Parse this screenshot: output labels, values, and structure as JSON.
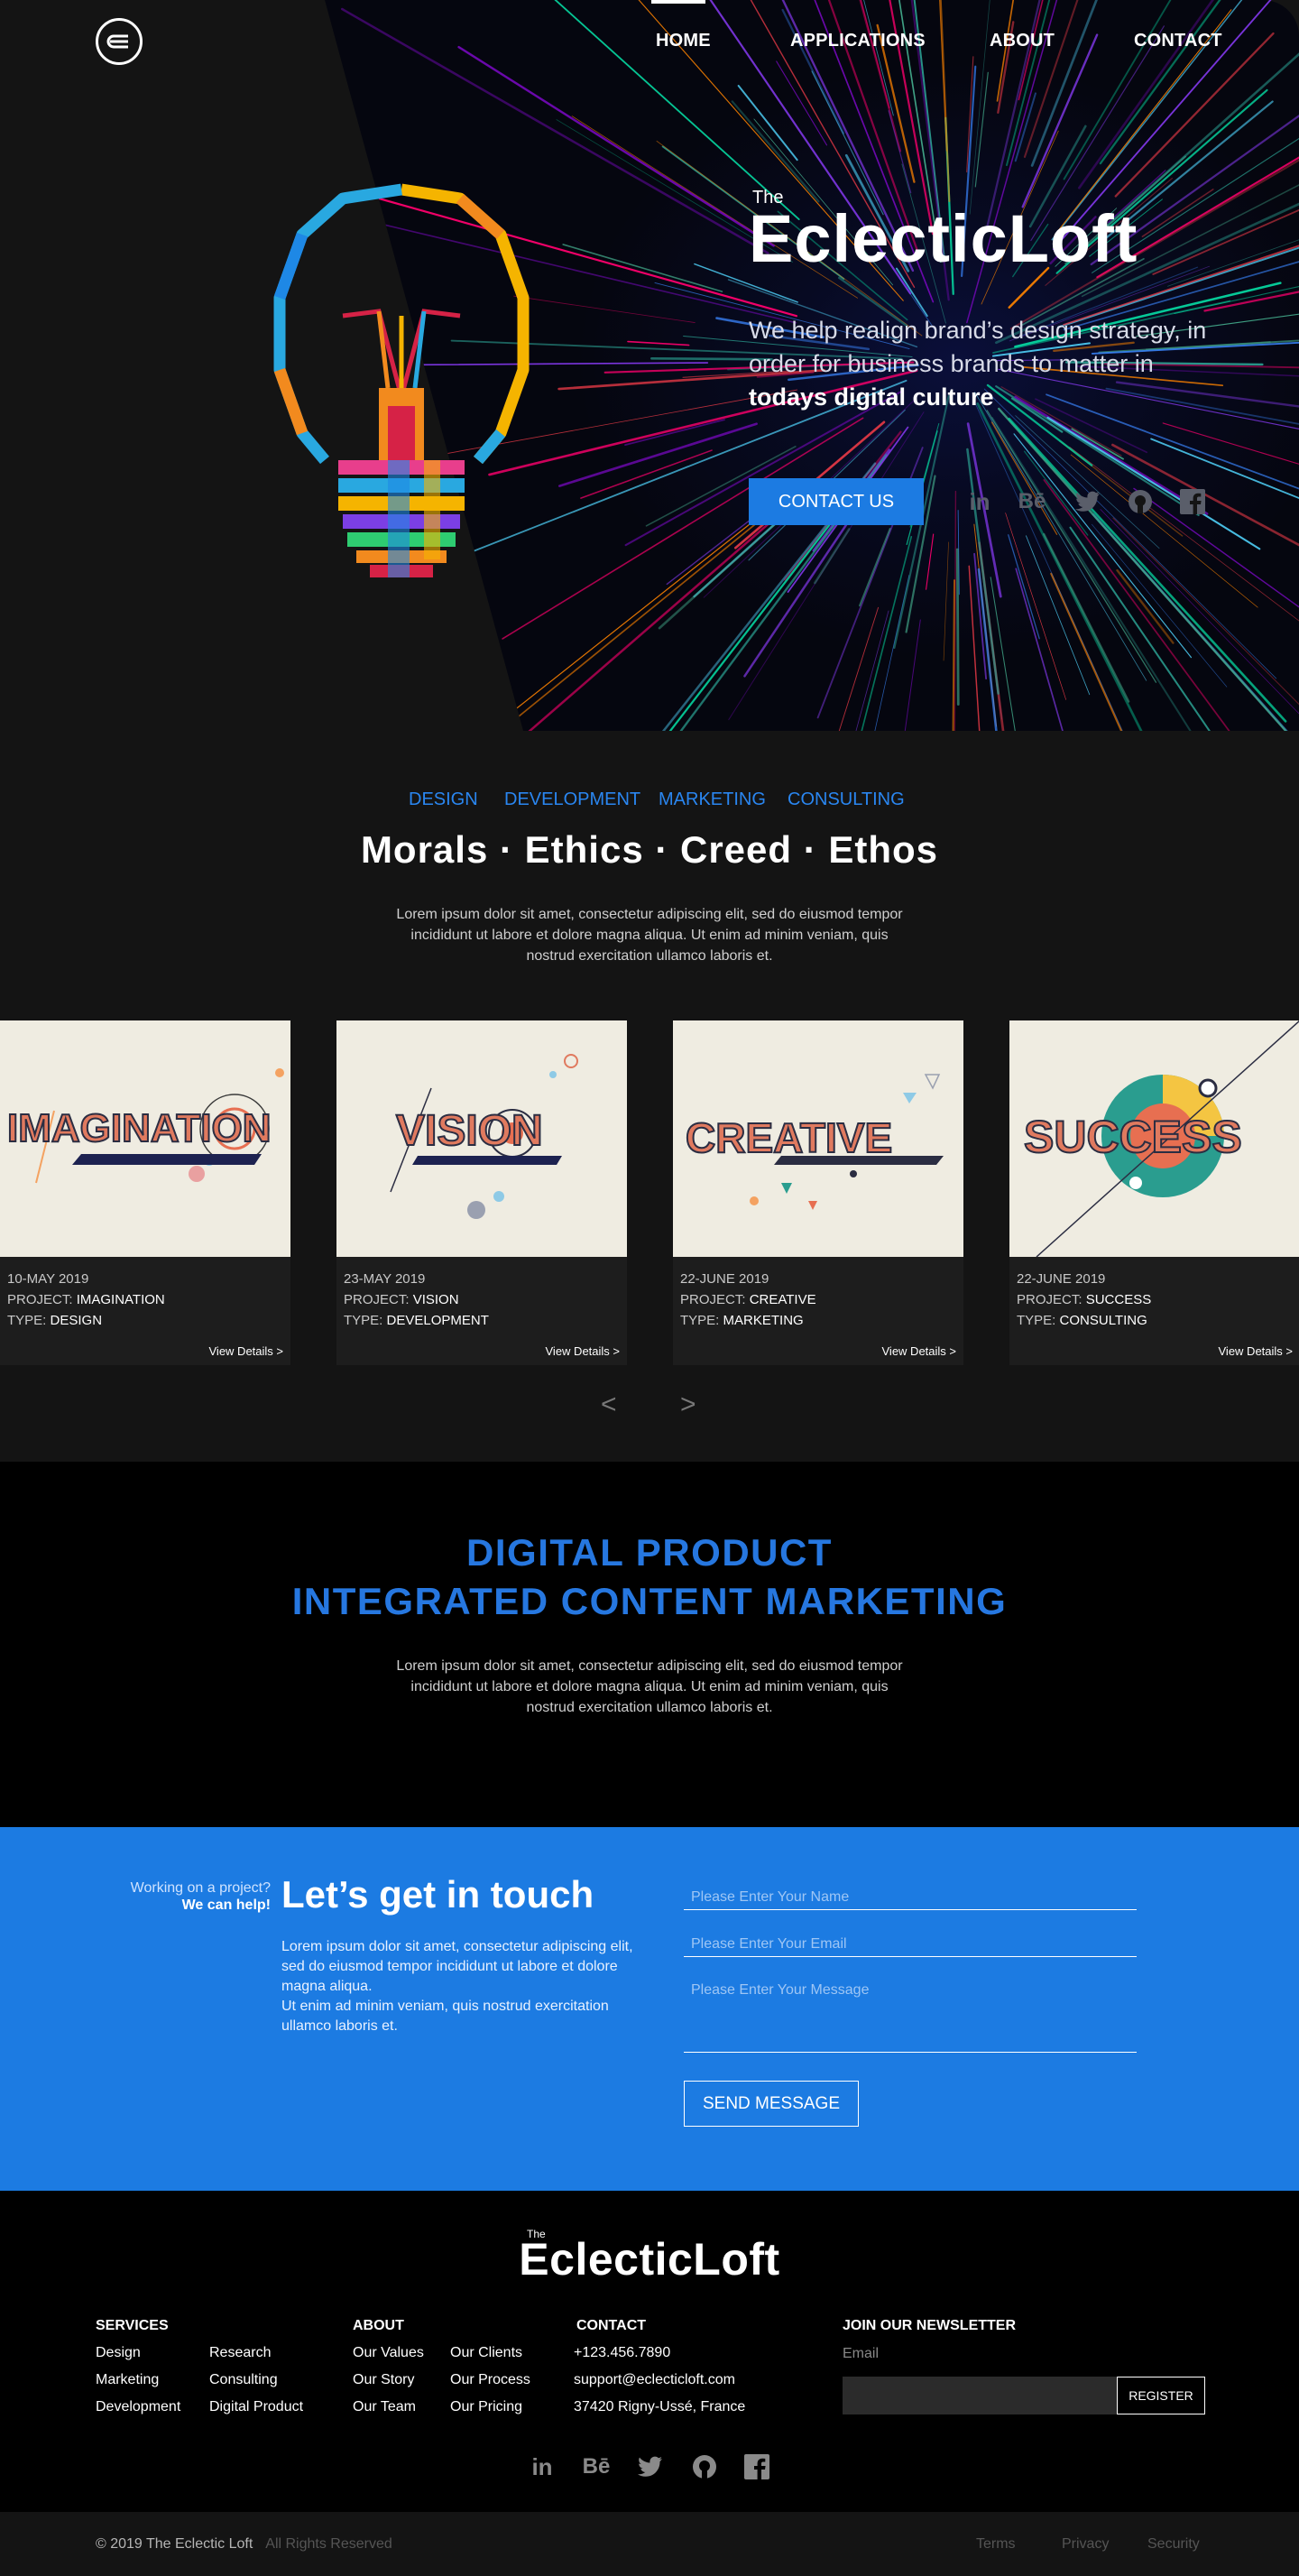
{
  "nav": {
    "items": [
      "HOME",
      "APPLICATIONS",
      "ABOUT",
      "CONTACT"
    ],
    "active": "HOME"
  },
  "hero": {
    "the": "The",
    "title": "EclecticLoft",
    "tagline": "We help realign brand’s design strategy, in order for business brands to matter in",
    "tagline_bold": "todays digital culture",
    "cta": "CONTACT US",
    "social_icons": [
      "linkedin-icon",
      "behance-icon",
      "twitter-icon",
      "github-icon",
      "facebook-icon"
    ],
    "accent": "#1c7be2"
  },
  "services": {
    "categories": [
      "DESIGN",
      "DEVELOPMENT",
      "MARKETING",
      "CONSULTING"
    ],
    "headline": "Morals · Ethics · Creed · Ethos",
    "body_line1": "Lorem ipsum dolor sit amet, consectetur adipiscing elit, sed do eiusmod tempor",
    "body_line2": "incididunt ut labore et dolore magna aliqua. Ut enim ad minim veniam, quis",
    "body_line3": "nostrud exercitation ullamco laboris et."
  },
  "projects": [
    {
      "word": "IMAGINATION",
      "date": "10-MAY 2019",
      "project_label": "PROJECT:",
      "project": "IMAGINATION",
      "type_label": "TYPE:",
      "type": "DESIGN",
      "link": "View Details >"
    },
    {
      "word": "VISION",
      "date": "23-MAY 2019",
      "project_label": "PROJECT:",
      "project": "VISION",
      "type_label": "TYPE:",
      "type": "DEVELOPMENT",
      "link": "View Details >"
    },
    {
      "word": "CREATIVE",
      "date": "22-JUNE 2019",
      "project_label": "PROJECT:",
      "project": "CREATIVE",
      "type_label": "TYPE:",
      "type": "MARKETING",
      "link": "View Details >"
    },
    {
      "word": "SUCCESS",
      "date": "22-JUNE 2019",
      "project_label": "PROJECT:",
      "project": "SUCCESS",
      "type_label": "TYPE:",
      "type": "CONSULTING",
      "link": "View Details >"
    }
  ],
  "carousel": {
    "prev": "<",
    "next": ">"
  },
  "digital": {
    "line1": "DIGITAL PRODUCT",
    "line2": "INTEGRATED CONTENT MARKETING",
    "body_line1": "Lorem ipsum dolor sit amet, consectetur adipiscing elit, sed do eiusmod tempor",
    "body_line2": "incididunt ut labore et dolore magna aliqua. Ut enim ad minim veniam, quis",
    "body_line3": "nostrud exercitation ullamco laboris et."
  },
  "contact": {
    "small1": "Working on a project?",
    "small2": "We can help!",
    "title": "Let’s get in touch",
    "body1": "Lorem ipsum dolor sit amet, consectetur adipiscing elit, sed do eiusmod tempor incididunt ut labore et dolore magna aliqua.",
    "body2": "Ut enim ad minim veniam, quis nostrud exercitation ullamco laboris et.",
    "name_placeholder": "Please Enter Your Name",
    "email_placeholder": "Please Enter Your Email",
    "message_placeholder": "Please Enter Your Message",
    "send": "SEND MESSAGE"
  },
  "footer": {
    "the": "The",
    "logo": "EclecticLoft",
    "services_head": "SERVICES",
    "services_col1": [
      "Design",
      "Marketing",
      "Development"
    ],
    "services_col2": [
      "Research",
      "Consulting",
      "Digital Product"
    ],
    "about_head": "ABOUT",
    "about_col1": [
      "Our Values",
      "Our Story",
      "Our Team"
    ],
    "about_col2": [
      "Our Clients",
      "Our Process",
      "Our Pricing"
    ],
    "contact_head": "CONTACT",
    "contact_lines": [
      "+123.456.7890",
      "support@eclecticloft.com",
      "37420 Rigny-Ussé, France"
    ],
    "newsletter_head": "JOIN OUR NEWSLETTER",
    "email_label": "Email",
    "register": "REGISTER",
    "copyright": "© 2019  The Eclectic Loft",
    "rights": "All Rights Reserved",
    "legal": [
      "Terms",
      "Privacy",
      "Security"
    ]
  }
}
